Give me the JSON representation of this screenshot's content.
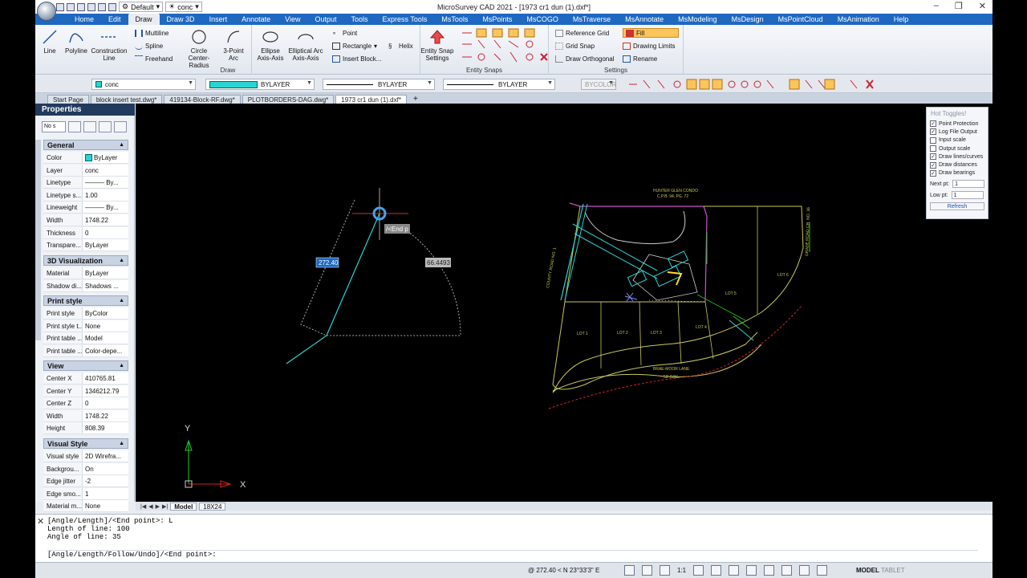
{
  "title": "MicroSurvey CAD 2021 - [1973 cr1 dun (1).dxf*]",
  "qat": {
    "workspace": "Default",
    "layer": "conc"
  },
  "menu_tabs": [
    "Home",
    "Edit",
    "Draw",
    "Draw 3D",
    "Insert",
    "Annotate",
    "View",
    "Output",
    "Tools",
    "Express Tools",
    "MsTools",
    "MsPoints",
    "MsCOGO",
    "MsTraverse",
    "MsAnnotate",
    "MsModeling",
    "MsDesign",
    "MsPointCloud",
    "MsAnimation",
    "Help"
  ],
  "ribbon": {
    "draw": {
      "label": "Draw",
      "line": "Line",
      "polyline": "Polyline",
      "construction": "Construction Line",
      "multiline": "Multiline",
      "spline": "Spline",
      "freehand": "Freehand",
      "circle": "Circle Center-Radius",
      "arc": "3-Point Arc",
      "ellipse": "Ellipse Axis-Axis",
      "elliptical": "Elliptical Arc Axis-Axis",
      "point": "Point",
      "rectangle": "Rectangle",
      "insert_block": "Insert Block...",
      "helix": "Helix"
    },
    "snaps": {
      "label": "Entity Snaps",
      "entity_snap_settings": "Entity Snap Settings"
    },
    "settings": {
      "label": "Settings",
      "reference_grid": "Reference Grid",
      "fill": "Fill",
      "grid_snap": "Grid Snap",
      "drawing_limits": "Drawing Limits",
      "draw_orthogonal": "Draw Orthogonal",
      "rename": "Rename"
    }
  },
  "toolbar2": {
    "layer": "conc",
    "color": "BYLAYER",
    "linetype": "BYLAYER",
    "lineweight": "BYLAYER",
    "plotstyle": "BYCOLOR"
  },
  "doc_tabs": [
    "Start Page",
    "block insert test.dwg*",
    "419134-Block-RF.dwg*",
    "PLOTBORDERS-DAG.dwg*",
    "1973 cr1 dun (1).dxf*"
  ],
  "properties": {
    "header": "Properties",
    "selection": "No s",
    "sections": {
      "general": "General",
      "viz": "3D Visualization",
      "print": "Print style",
      "view": "View",
      "visual": "Visual Style"
    },
    "general": [
      {
        "k": "Color",
        "v": "ByLayer"
      },
      {
        "k": "Layer",
        "v": "conc"
      },
      {
        "k": "Linetype",
        "v": "——— By..."
      },
      {
        "k": "Linetype s...",
        "v": "1.00"
      },
      {
        "k": "Lineweight",
        "v": "——— By..."
      },
      {
        "k": "Width",
        "v": "1748.22"
      },
      {
        "k": "Thickness",
        "v": "0"
      },
      {
        "k": "Transpare...",
        "v": "ByLayer"
      }
    ],
    "viz": [
      {
        "k": "Material",
        "v": "ByLayer"
      },
      {
        "k": "Shadow di...",
        "v": "Shadows ..."
      }
    ],
    "print": [
      {
        "k": "Print style",
        "v": "ByColor"
      },
      {
        "k": "Print style t...",
        "v": "None"
      },
      {
        "k": "Print table ...",
        "v": "Model"
      },
      {
        "k": "Print table ...",
        "v": "Color-depe..."
      }
    ],
    "view": [
      {
        "k": "Center X",
        "v": "410765.81"
      },
      {
        "k": "Center Y",
        "v": "1346212.79"
      },
      {
        "k": "Center Z",
        "v": "0"
      },
      {
        "k": "Width",
        "v": "1748.22"
      },
      {
        "k": "Height",
        "v": "808.39"
      }
    ],
    "visual": [
      {
        "k": "Visual style",
        "v": "2D Wirefra..."
      },
      {
        "k": "Backgrou...",
        "v": "On"
      },
      {
        "k": "Edge jitter",
        "v": "-2"
      },
      {
        "k": "Edge smo...",
        "v": "1"
      },
      {
        "k": "Material m...",
        "v": "None"
      }
    ]
  },
  "hot_toggles": {
    "title": "Hot Toggles!",
    "items": [
      {
        "label": "Point Protection",
        "checked": true
      },
      {
        "label": "Log File Output",
        "checked": true
      },
      {
        "label": "Input scale",
        "checked": false
      },
      {
        "label": "Output scale",
        "checked": false
      },
      {
        "label": "Draw lines/curves",
        "checked": true
      },
      {
        "label": "Draw distances",
        "checked": true
      },
      {
        "label": "Draw bearings",
        "checked": true
      }
    ],
    "next_pt_label": "Next pt:",
    "next_pt": "1",
    "low_pt_label": "Low pt:",
    "low_pt": "1",
    "refresh": "Refresh"
  },
  "drawing": {
    "dim_length": "272.40",
    "dim_angle": "66.4493",
    "tooltip": "/<End p",
    "axis_x": "X",
    "axis_y": "Y",
    "labels": {
      "condo": "HUNTER GLEN CONDO",
      "plan": "C.P.B. 94, PG. 72",
      "road_left": "COUNTY ROAD NO. 1",
      "road_right": "GRADE ROAD CR. NO. 36",
      "lot5": "LOT 5",
      "lot6": "LOT 6",
      "lot1": "LOT 1",
      "lot2": "LOT 2",
      "lot3": "LOT 3",
      "lot4": "LOT 4",
      "lane": "BRAE-MOOR LANE",
      "lane_row": "50' R/W"
    }
  },
  "layout_tabs": [
    "Model",
    "18X24"
  ],
  "command": {
    "history": [
      "[Angle/Length]/<End point>: L",
      "Length of line: 100",
      "Angle of line: 35"
    ],
    "prompt": "[Angle/Length/Follow/Undo]/<End point>:"
  },
  "status": {
    "coords": "@ 272.40 < N 23°33'3\" E",
    "scale": "1:1",
    "model": "MODEL",
    "tablet": "TABLET"
  },
  "colors": {
    "menu": "#1f68c0",
    "props_header": "#223a5e",
    "canvas": "#000000",
    "fill_btn": "#fbc55c"
  }
}
